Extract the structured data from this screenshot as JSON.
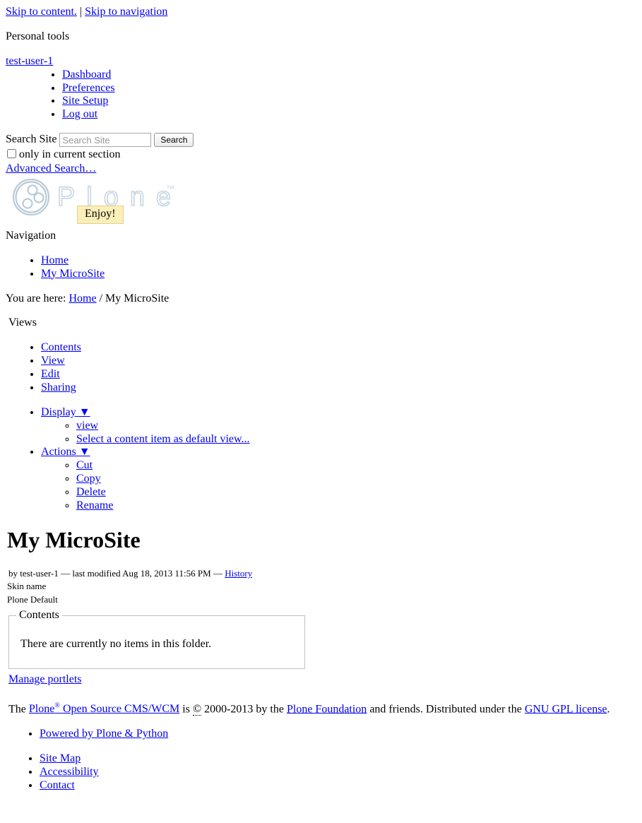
{
  "skiplinks": {
    "content": "Skip to content.",
    "separator": "|",
    "navigation": "Skip to navigation"
  },
  "personal_tools": {
    "heading": "Personal tools",
    "user": "test-user-1",
    "items": [
      {
        "label": "Dashboard"
      },
      {
        "label": "Preferences"
      },
      {
        "label": "Site Setup"
      },
      {
        "label": "Log out"
      }
    ]
  },
  "search": {
    "label": "Search Site",
    "placeholder": "Search Site",
    "value": "",
    "button_label": "Search",
    "current_section_label": "only in current section",
    "current_section_checked": false,
    "advanced_label": "Advanced Search…"
  },
  "logo": {
    "wordmark": "Plone",
    "trademark": "™",
    "color": "#b8cbd9",
    "tooltip": "Enjoy!",
    "tooltip_bg": "#fbefb9",
    "tooltip_border": "#e4d18a"
  },
  "navigation": {
    "heading": "Navigation",
    "items": [
      {
        "label": "Home"
      },
      {
        "label": "My MicroSite"
      }
    ]
  },
  "breadcrumb": {
    "prefix": "You are here:",
    "home": "Home",
    "separator": "/",
    "current": "My MicroSite"
  },
  "views": {
    "heading": "Views",
    "primary": [
      {
        "label": "Contents"
      },
      {
        "label": "View"
      },
      {
        "label": "Edit"
      },
      {
        "label": "Sharing"
      }
    ],
    "display": {
      "label": "Display",
      "caret": "▼",
      "items": [
        {
          "label": "view"
        },
        {
          "label": "Select a content item as default view..."
        }
      ]
    },
    "actions": {
      "label": "Actions",
      "caret": "▼",
      "items": [
        {
          "label": "Cut"
        },
        {
          "label": "Copy"
        },
        {
          "label": "Delete"
        },
        {
          "label": "Rename"
        }
      ]
    }
  },
  "document": {
    "title": "My MicroSite",
    "byline_author": "by test-user-1",
    "byline_dash1": "—",
    "byline_modified": "last modified Aug 18, 2013 11:56 PM",
    "byline_dash2": "—",
    "byline_history": "History",
    "skin_label": "Skin name",
    "skin_value": "Plone Default",
    "contents_legend": "Contents",
    "contents_empty": "There are currently no items in this folder.",
    "manage_portlets": "Manage portlets"
  },
  "footer": {
    "text_1": "The",
    "link_plone": "Plone",
    "plone_reg": "®",
    "link_plone_rest": "Open Source CMS/WCM",
    "text_2": "is",
    "copyright_symbol": "©",
    "text_3": "2000-2013 by the",
    "link_foundation": "Plone Foundation",
    "text_4": "and friends. Distributed under the",
    "link_license": "GNU GPL license",
    "text_5": ".",
    "colophon": [
      {
        "label": "Powered by Plone & Python"
      }
    ],
    "site_actions": [
      {
        "label": "Site Map"
      },
      {
        "label": "Accessibility"
      },
      {
        "label": "Contact"
      }
    ]
  }
}
